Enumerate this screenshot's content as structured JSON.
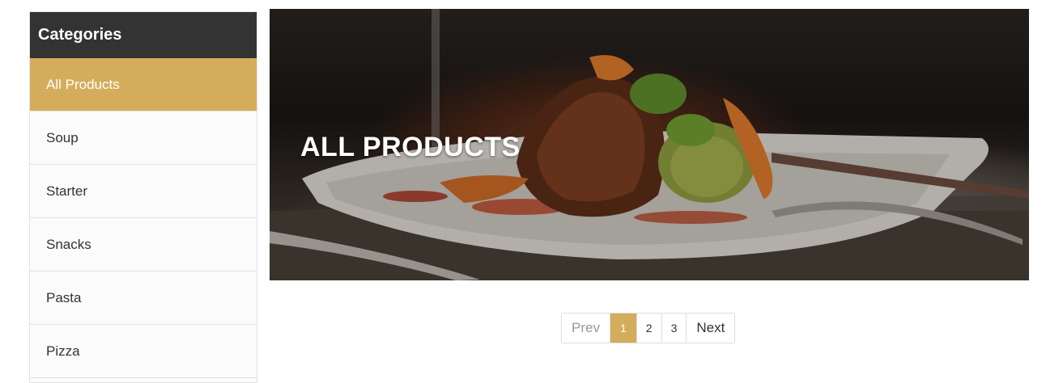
{
  "sidebar": {
    "title": "Categories",
    "items": [
      {
        "label": "All Products",
        "active": true
      },
      {
        "label": "Soup",
        "active": false
      },
      {
        "label": "Starter",
        "active": false
      },
      {
        "label": "Snacks",
        "active": false
      },
      {
        "label": "Pasta",
        "active": false
      },
      {
        "label": "Pizza",
        "active": false
      }
    ]
  },
  "hero": {
    "title": "ALL PRODUCTS",
    "image": "plated-steak-dish"
  },
  "pagination": {
    "prev": "Prev",
    "pages": [
      "1",
      "2",
      "3"
    ],
    "current": "1",
    "next": "Next"
  },
  "colors": {
    "accent": "#d4ad5c",
    "header_bg": "#333333"
  }
}
